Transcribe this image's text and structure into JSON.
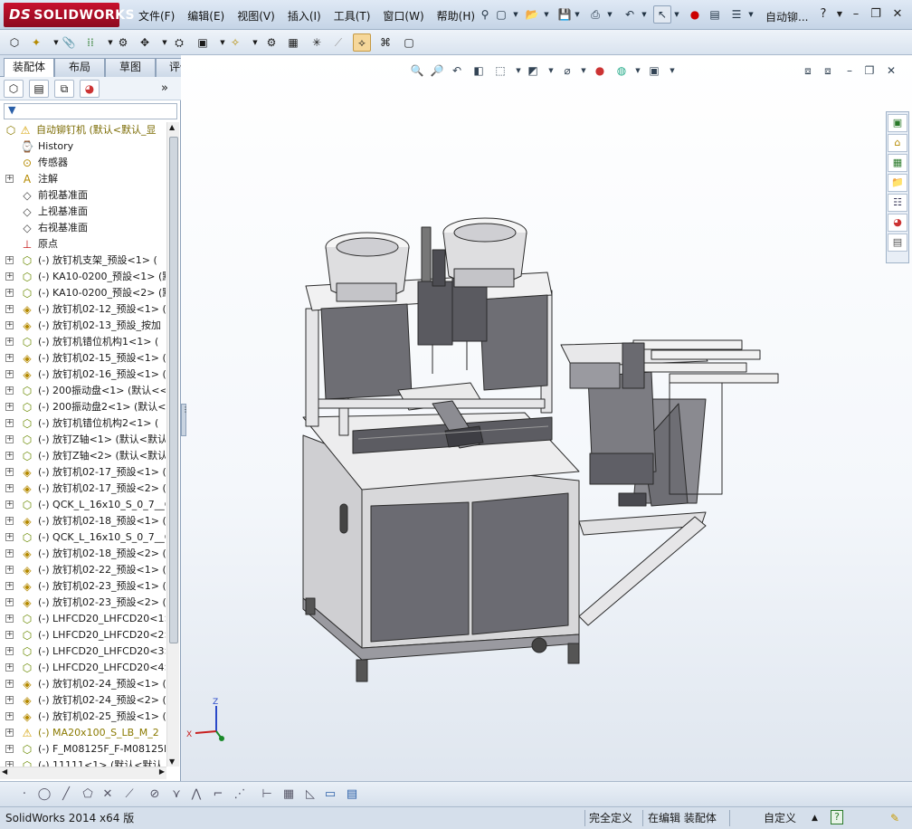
{
  "app": {
    "logo_text": "SOLIDWORKS",
    "logo_ds": "DS",
    "document_title": "自动铆...",
    "help_icon": "?"
  },
  "menu": [
    "文件(F)",
    "编辑(E)",
    "视图(V)",
    "插入(I)",
    "工具(T)",
    "窗口(W)",
    "帮助(H)"
  ],
  "command_tabs": [
    "装配体",
    "布局",
    "草图",
    "评估"
  ],
  "active_tab": "装配体",
  "feature_tree": {
    "root_label": "自动铆钉机  (默认<默认_显",
    "items": [
      {
        "label": "History",
        "icon": "history-icon",
        "expandable": false
      },
      {
        "label": "传感器",
        "icon": "sensor-icon",
        "expandable": false
      },
      {
        "label": "注解",
        "icon": "annotation-icon",
        "expandable": true
      },
      {
        "label": "前视基准面",
        "icon": "plane-icon",
        "expandable": false
      },
      {
        "label": "上视基准面",
        "icon": "plane-icon",
        "expandable": false
      },
      {
        "label": "右视基准面",
        "icon": "plane-icon",
        "expandable": false
      },
      {
        "label": "原点",
        "icon": "origin-icon",
        "expandable": false
      },
      {
        "label": "(-) 放钉机支架_预設<1> (",
        "icon": "assembly-icon",
        "expandable": true
      },
      {
        "label": "(-) KA10-0200_预設<1> (默",
        "icon": "assembly-icon",
        "expandable": true
      },
      {
        "label": "(-) KA10-0200_预設<2> (默",
        "icon": "assembly-icon",
        "expandable": true
      },
      {
        "label": "(-) 放钉机02-12_预設<1> (",
        "icon": "part-icon",
        "expandable": true
      },
      {
        "label": "(-) 放钉机02-13_预設_按加",
        "icon": "part-icon",
        "expandable": true
      },
      {
        "label": "(-) 放钉机错位机构1<1> (",
        "icon": "assembly-icon",
        "expandable": true
      },
      {
        "label": "(-) 放钉机02-15_预設<1> (",
        "icon": "part-icon",
        "expandable": true
      },
      {
        "label": "(-) 放钉机02-16_预設<1> (",
        "icon": "part-icon",
        "expandable": true
      },
      {
        "label": "(-) 200振动盘<1> (默认<<",
        "icon": "assembly-icon",
        "expandable": true
      },
      {
        "label": "(-) 200振动盘2<1> (默认<",
        "icon": "assembly-icon",
        "expandable": true
      },
      {
        "label": "(-) 放钉机错位机构2<1> (",
        "icon": "assembly-icon",
        "expandable": true
      },
      {
        "label": "(-) 放钉Z轴<1> (默认<默认",
        "icon": "assembly-icon",
        "expandable": true
      },
      {
        "label": "(-) 放钉Z轴<2> (默认<默认",
        "icon": "assembly-icon",
        "expandable": true
      },
      {
        "label": "(-) 放钉机02-17_预設<1> (",
        "icon": "part-icon",
        "expandable": true
      },
      {
        "label": "(-) 放钉机02-17_预設<2> (",
        "icon": "part-icon",
        "expandable": true
      },
      {
        "label": "(-) QCK_L_16x10_S_0_7__Q",
        "icon": "assembly-icon",
        "expandable": true
      },
      {
        "label": "(-) 放钉机02-18_预設<1> (",
        "icon": "part-icon",
        "expandable": true
      },
      {
        "label": "(-) QCK_L_16x10_S_0_7__Q",
        "icon": "assembly-icon",
        "expandable": true
      },
      {
        "label": "(-) 放钉机02-18_预設<2> (",
        "icon": "part-icon",
        "expandable": true
      },
      {
        "label": "(-) 放钉机02-22_预設<1> (",
        "icon": "part-icon",
        "expandable": true
      },
      {
        "label": "(-) 放钉机02-23_预設<1> (",
        "icon": "part-icon",
        "expandable": true
      },
      {
        "label": "(-) 放钉机02-23_预設<2> (",
        "icon": "part-icon",
        "expandable": true
      },
      {
        "label": "(-) LHFCD20_LHFCD20<1> (",
        "icon": "assembly-icon",
        "expandable": true
      },
      {
        "label": "(-) LHFCD20_LHFCD20<2> (",
        "icon": "assembly-icon",
        "expandable": true
      },
      {
        "label": "(-) LHFCD20_LHFCD20<3> (",
        "icon": "assembly-icon",
        "expandable": true
      },
      {
        "label": "(-) LHFCD20_LHFCD20<4> (",
        "icon": "assembly-icon",
        "expandable": true
      },
      {
        "label": "(-) 放钉机02-24_预設<1> (",
        "icon": "part-icon",
        "expandable": true
      },
      {
        "label": "(-) 放钉机02-24_预設<2> (",
        "icon": "part-icon",
        "expandable": true
      },
      {
        "label": "(-) 放钉机02-25_预設<1> (",
        "icon": "part-icon",
        "expandable": true
      },
      {
        "label": "(-) MA20x100_S_LB_M_2",
        "icon": "warning-assembly-icon",
        "expandable": true,
        "warning": true
      },
      {
        "label": "(-) F_M08125F_F-M08125F-",
        "icon": "assembly-icon",
        "expandable": true
      },
      {
        "label": "(-) 11111<1> (默认<默认_",
        "icon": "assembly-icon",
        "expandable": true
      }
    ]
  },
  "triad": {
    "x": "X",
    "y": "Y",
    "z": "Z"
  },
  "status": {
    "app_version": "SolidWorks 2014 x64 版",
    "definition": "完全定义",
    "mode": "在编辑 装配体",
    "units": "自定义"
  },
  "colors": {
    "accent": "#c8102e",
    "tree_warning": "#8b7a00",
    "active_tool": "#f6d79a"
  }
}
